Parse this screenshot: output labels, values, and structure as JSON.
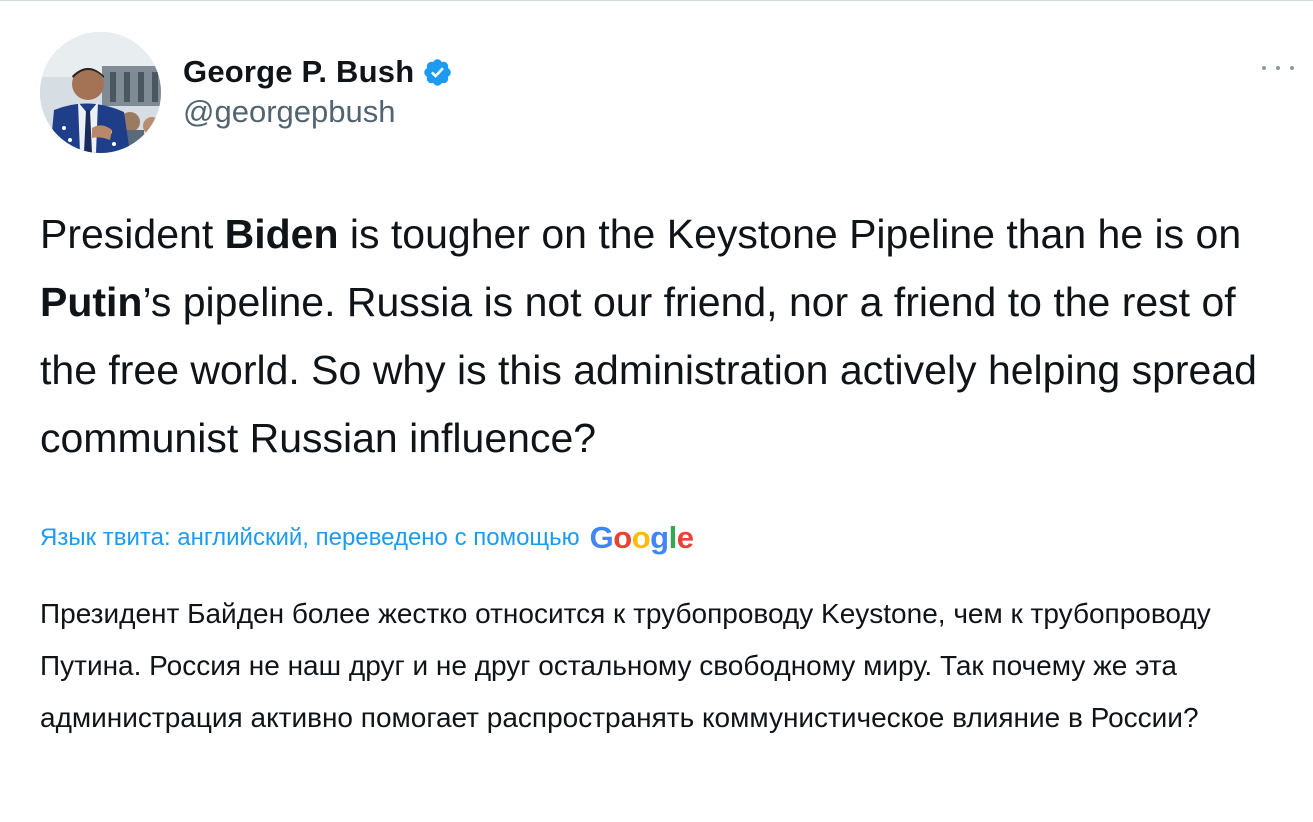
{
  "author": {
    "display_name": "George P. Bush",
    "handle": "@georgepbush",
    "verified": true,
    "verified_icon": "verified-badge-icon",
    "avatar_icon": "profile-photo"
  },
  "menu": {
    "icon": "more-options-icon"
  },
  "tweet": {
    "parts": [
      "President ",
      "Biden",
      " is tougher on the Keystone Pipeline than he is on ",
      "Putin",
      "’s pipeline. Russia is not our friend, nor a friend to the rest of the free world. So why is this administration actively helping spread communist Russian influence?"
    ]
  },
  "translation": {
    "label": "Язык твита: английский, переведено с помощью",
    "provider": [
      "G",
      "o",
      "o",
      "g",
      "l",
      "e"
    ],
    "text": "Президент Байден более жестко относится к трубопроводу Keystone, чем к трубопроводу Путина. Россия не наш друг и не друг остальному свободному миру. Так почему же эта администрация активно помогает распространять коммунистическое влияние в России?"
  },
  "colors": {
    "link": "#1d9bf0",
    "verified": "#1d9bf0",
    "text": "#0f1419",
    "secondary": "#536471"
  }
}
